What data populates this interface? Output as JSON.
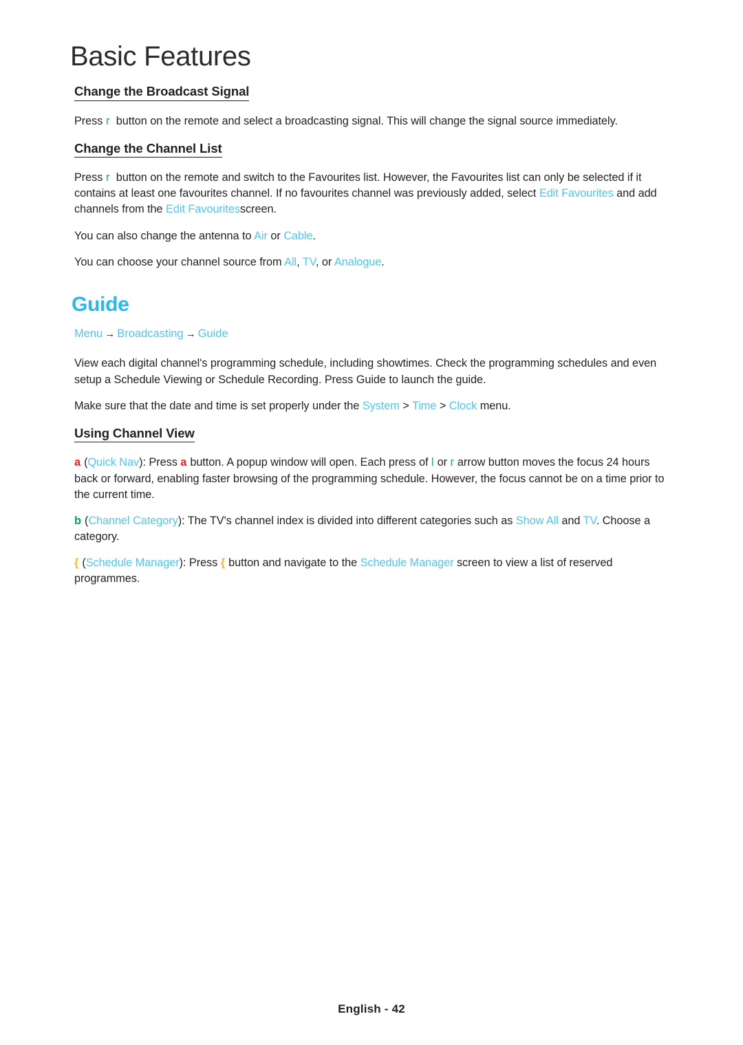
{
  "document": {
    "title": "Basic Features",
    "footer": "English - 42"
  },
  "colors": {
    "accent_blue": "#29b8ef",
    "link_cyan": "#4fc6f2",
    "key_teal": "#17a88f",
    "key_red": "#ed2024",
    "key_green": "#00a651",
    "key_yellow": "#fcb913",
    "text": "#231f20"
  },
  "sections": {
    "broadcast_signal": {
      "heading": "Change the Broadcast Signal",
      "para1": {
        "t1": "Press",
        "key": "r",
        "t2": "button on the remote and select a broadcasting signal. This will change the signal source immediately."
      }
    },
    "channel_list": {
      "heading": "Change the Channel List",
      "para1": {
        "t1": "Press",
        "key": "r",
        "t2": "button on the remote and switch to the Favourites list. However, the Favourites list can only be selected if it contains at least one favourites channel. If no favourites channel was previously added, select",
        "term1": "Edit Favourites",
        "t3": "and add channels from the",
        "term2": "Edit Favourites",
        "t4": "screen."
      },
      "para2": {
        "t1": "You can also change the antenna to",
        "term1": "Air",
        "t2": "or",
        "term2": "Cable",
        "t3": "."
      },
      "para3": {
        "t1": "You can choose your channel source from",
        "term1": "All",
        "t2": ",",
        "term2": "TV",
        "t3": ", or",
        "term3": "Analogue",
        "t4": "."
      }
    },
    "guide": {
      "heading": "Guide",
      "breadcrumb": {
        "item1": "Menu",
        "arrow1": "→",
        "item2": "Broadcasting",
        "arrow2": "→",
        "item3": "Guide"
      },
      "para1": "View each digital channel's programming schedule, including showtimes. Check the programming schedules and even setup a Schedule Viewing or Schedule Recording. Press Guide to launch the guide.",
      "para2": {
        "t1": "Make sure that the date and time is set properly under the",
        "term1": "System",
        "sep1": ">",
        "term2": "Time",
        "sep2": ">",
        "term3": "Clock",
        "t2": "menu."
      }
    },
    "channel_view": {
      "heading": "Using Channel View",
      "item_a": {
        "key": "a",
        "t1": "(",
        "term1": "Quick Nav",
        "t2": "): Press",
        "key2": "a",
        "t3": "button. A popup window will open. Each press of",
        "key3": "l",
        "t4": "or",
        "key4": "r",
        "t5": "arrow button moves the focus 24 hours back or forward, enabling faster browsing of the programming schedule. However, the focus cannot be on a time prior to the current time."
      },
      "item_b": {
        "key": "b",
        "t1": "(",
        "term1": "Channel Category",
        "t2": "): The TV's channel index is divided into different categories such as",
        "term2": "Show All",
        "t3": "and",
        "term3": "TV",
        "t4": ". Choose a category."
      },
      "item_c": {
        "key": "{",
        "t1": "(",
        "term1": "Schedule Manager",
        "t2": "): Press",
        "key2": "{",
        "t3": "button and navigate to the",
        "term2": "Schedule Manager",
        "t4": "screen to view a list of reserved programmes."
      }
    }
  }
}
